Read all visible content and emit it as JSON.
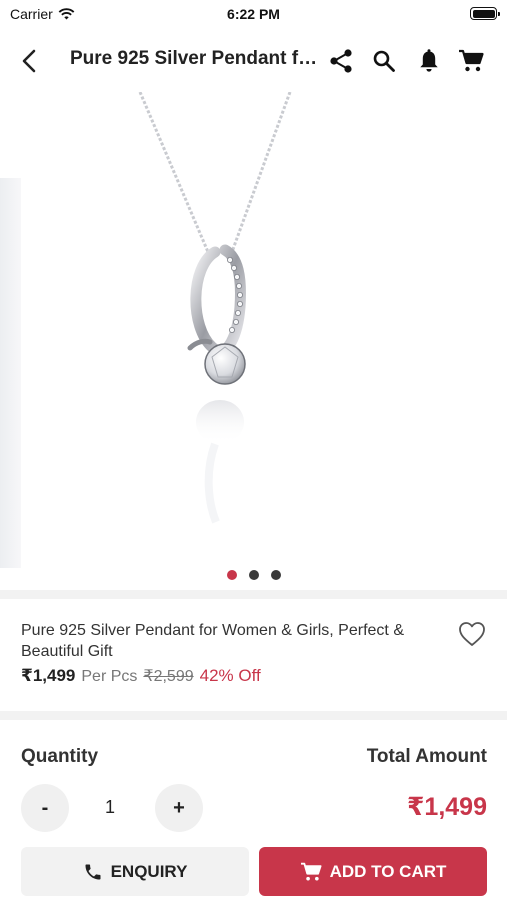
{
  "status_bar": {
    "carrier": "Carrier",
    "time": "6:22 PM"
  },
  "nav": {
    "title": "Pure 925 Silver Pendant for Women & Girls, Perfect & Beautiful Gift",
    "icons": [
      "back-arrow-icon",
      "share-icon",
      "search-icon",
      "bell-icon",
      "cart-icon"
    ]
  },
  "gallery": {
    "image_count": 3,
    "active_index": 0
  },
  "product": {
    "name": "Pure 925 Silver Pendant for Women & Girls, Perfect & Beautiful Gift",
    "price": "₹1,499",
    "unit": "Per Pcs",
    "mrp": "₹2,599",
    "discount": "42% Off"
  },
  "purchase": {
    "quantity_label": "Quantity",
    "quantity": "1",
    "decrement_label": "-",
    "increment_label": "+",
    "total_label": "Total Amount",
    "total_value": "₹1,499"
  },
  "actions": {
    "enquiry_label": "ENQUIRY",
    "add_to_cart_label": "ADD TO CART"
  },
  "colors": {
    "accent": "#c8364a",
    "text": "#222222",
    "muted": "#777777",
    "button_bg": "#f2f2f2"
  }
}
